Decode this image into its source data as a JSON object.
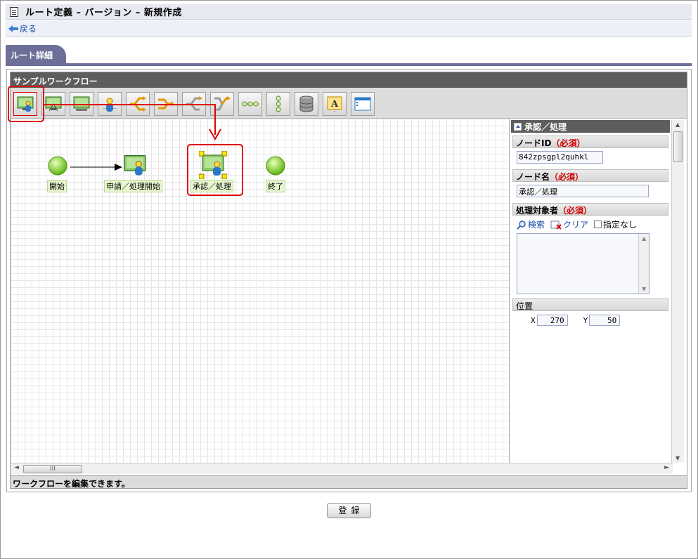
{
  "title": "ルート定義 – バージョン – 新規作成",
  "back_label": "戻る",
  "tab_label": "ルート詳細",
  "workflow": {
    "name": "サンプルワークフロー",
    "status": "ワークフローを編集できます。",
    "nodes": {
      "start": "開始",
      "apply": "申請／処理開始",
      "approve": "承認／処理",
      "end": "終了"
    }
  },
  "toolbar": {
    "icons": [
      "process-node-icon",
      "apply-node-icon",
      "approve-node-icon",
      "user-node-icon",
      "branch-node-icon",
      "branch-all-node-icon",
      "merge-node-icon",
      "join-node-icon",
      "horizontal-line-icon",
      "vertical-line-icon",
      "database-icon",
      "text-annotation-icon",
      "frame-icon"
    ]
  },
  "properties": {
    "header": "承認／処理",
    "node_id_label": "ノードID",
    "node_id_value": "842zpsgpl2quhkl",
    "node_name_label": "ノード名",
    "node_name_value": "承認／処理",
    "target_label": "処理対象者",
    "required": "（必須）",
    "search_label": "検索",
    "clear_label": "クリア",
    "unspecified_label": "指定なし",
    "position_label": "位置",
    "x_label": "X",
    "x_value": "270",
    "y_label": "Y",
    "y_value": "50"
  },
  "register_label": "登録",
  "colors": {
    "tab": "#6d6f98",
    "header": "#5d5d5d",
    "highlight": "#e00000",
    "node_label_bg": "#e8f6cf"
  }
}
